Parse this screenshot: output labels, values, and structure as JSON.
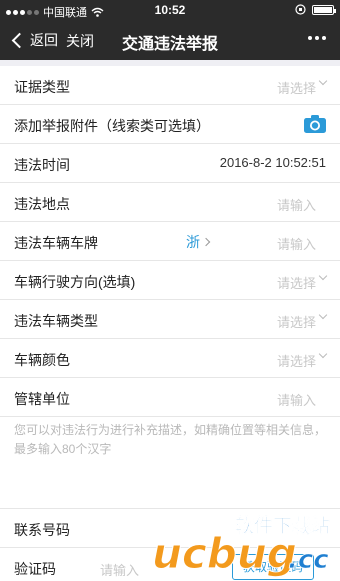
{
  "status_bar": {
    "carrier": "中国联通",
    "time": "10:52"
  },
  "navbar": {
    "back_label": "返回",
    "close_label": "关闭",
    "title": "交通违法举报"
  },
  "form": {
    "evidence_type": {
      "label": "证据类型",
      "placeholder": "请选择"
    },
    "attachment": {
      "label": "添加举报附件（线索类可选填）"
    },
    "violation_time": {
      "label": "违法时间",
      "value": "2016-8-2 10:52:51"
    },
    "violation_place": {
      "label": "违法地点",
      "placeholder": "请输入"
    },
    "plate": {
      "label": "违法车辆车牌",
      "province": "浙",
      "placeholder": "请输入"
    },
    "direction": {
      "label": "车辆行驶方向(选填)",
      "placeholder": "请选择"
    },
    "vehicle_type": {
      "label": "违法车辆类型",
      "placeholder": "请选择"
    },
    "vehicle_color": {
      "label": "车辆颜色",
      "placeholder": "请选择"
    },
    "jurisdiction": {
      "label": "管辖单位",
      "placeholder": "请输入"
    }
  },
  "description": {
    "placeholder": "您可以对违法行为进行补充描述，如精确位置等相关信息，最多输入80个汉字"
  },
  "contact": {
    "phone": {
      "label": "联系号码"
    },
    "code": {
      "label": "验证码",
      "placeholder": "请输入",
      "button": "获取验证码"
    }
  },
  "watermark": {
    "brand": "ucbug",
    "suffix": ".cc",
    "tagline": "软件下载站"
  },
  "colors": {
    "bar": "#2b2b2b",
    "accent": "#2b9ad8",
    "background": "#efeff4",
    "watermark_orange": "#f39a1d",
    "watermark_blue": "#1f7fd1"
  }
}
